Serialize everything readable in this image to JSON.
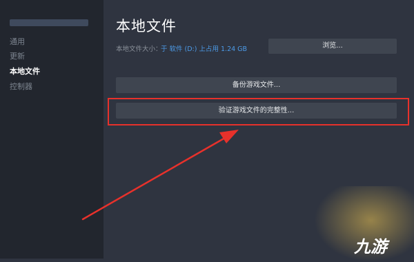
{
  "sidebar": {
    "items": [
      {
        "label": "通用",
        "active": false
      },
      {
        "label": "更新",
        "active": false
      },
      {
        "label": "本地文件",
        "active": true
      },
      {
        "label": "控制器",
        "active": false
      }
    ]
  },
  "main": {
    "title": "本地文件",
    "size_label": "本地文件大小：",
    "size_value": "于 软件 (D:) 上占用 1.24 GB",
    "browse_label": "浏览...",
    "backup_label": "备份游戏文件...",
    "verify_label": "验证游戏文件的完整性..."
  },
  "annotation": {
    "highlight_color": "#e8312b",
    "arrow_color": "#e8312b"
  },
  "watermark": {
    "text": "九游"
  },
  "colors": {
    "accent_link": "#4c9be8",
    "background": "#2f3440",
    "sidebar": "#22262e",
    "button": "#3f4550"
  }
}
